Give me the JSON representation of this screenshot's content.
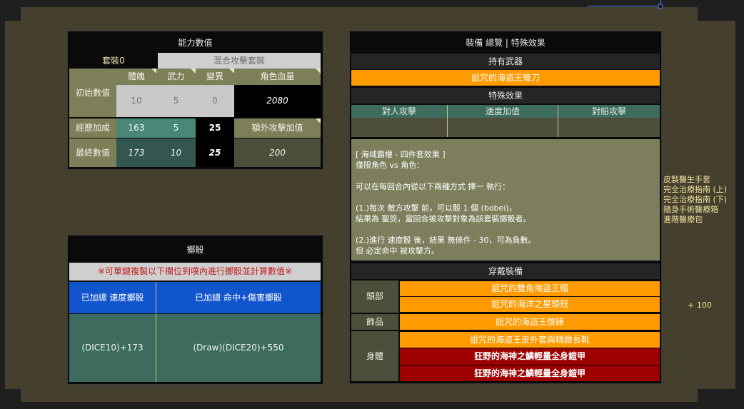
{
  "stats": {
    "title": "能力數值",
    "set_label": "套裝0",
    "mixed_attack_label": "混合攻擊套裝",
    "headers": [
      "體魄",
      "武力",
      "變異",
      "角色血量"
    ],
    "initial_label": "初始數值",
    "initial_values": [
      "10",
      "5",
      "0",
      "2080"
    ],
    "exp_label": "經歷加成",
    "exp_values": [
      "163",
      "5",
      "25"
    ],
    "extra_attack_label": "額外攻擊加值",
    "final_label": "最終數值",
    "final_values": [
      "173",
      "10",
      "25",
      "200"
    ]
  },
  "dice": {
    "title": "擲骰",
    "notice": "※可單鍵複製以下欄位到噗內進行擲骰並計算數值※",
    "col1_header": "已加總 速度擲骰",
    "col2_header": "已加總 命中+傷害擲骰",
    "col1_value": "(DICE10)+173",
    "col2_value": "(Draw)(DICE20)+550"
  },
  "equip": {
    "title": "裝備 總覽 | 特殊效果",
    "weapon_header": "持有武器",
    "weapon_name": "詛咒的海盜王彎刀",
    "effect_header": "特殊效果",
    "effect_cols": [
      "對人攻擊",
      "速度加值",
      "對船攻擊"
    ],
    "description": [
      "[ 海域霸權 - 四件套效果 ]",
      "僅限角色 vs 角色：",
      "",
      "可以在每回合內從以下兩種方式 擇一 執行：",
      "",
      "(1.)每次 敵方攻擊 前，可以骰 1 個 (bobei)，",
      "結果為 聖筊，當回合被攻擊對象為該套裝擲骰者。",
      "",
      "(2.)進行 速度骰 後，結果 無條件 - 30，可為負數。",
      "但 必定命中 被攻擊方。"
    ],
    "worn_header": "穿戴裝備",
    "slots": {
      "head_label": "頭部",
      "head_items": [
        "詛咒的雙角海盜王帽",
        "詛咒的海洋之星頭冠"
      ],
      "accessory_label": "飾品",
      "accessory_items": [
        "詛咒的海盜王懷錶"
      ],
      "body_label": "身體",
      "body_items": [
        "詛咒的海盜王皮外套與精緻長靴",
        "狂野的海神之鱗輕量全身鎧甲",
        "狂野的海神之鱗輕量全身鎧甲"
      ]
    }
  },
  "side": {
    "items": [
      "皮製醫生手套",
      "完全治療指南 (上)",
      "完全治療指南 (下)",
      "隨身手術醫療箱",
      "進階醫療包"
    ],
    "bonus": "+ 100"
  },
  "colors": {
    "frame": "#453f2d",
    "olive": "#7d7f58",
    "teal": "#3d6b5e",
    "orange": "#ff9b00",
    "red": "#9c0000",
    "blue": "#1155cc"
  }
}
